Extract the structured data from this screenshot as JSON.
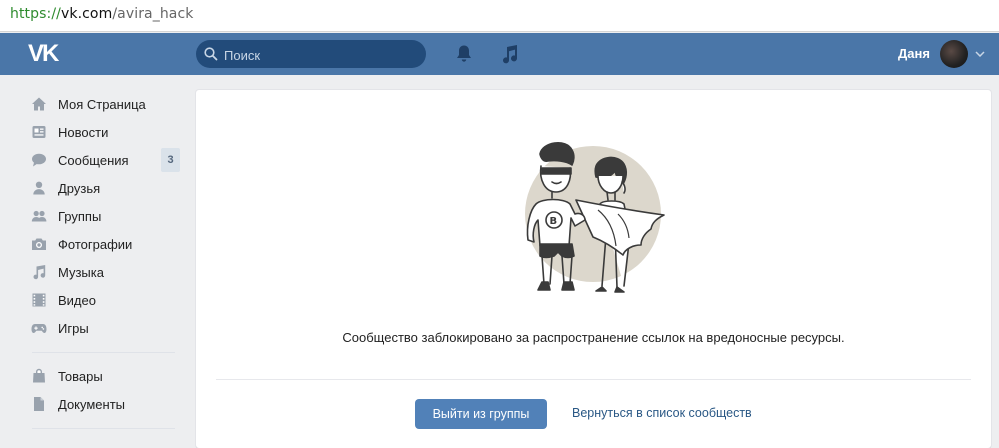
{
  "browser": {
    "url_scheme": "https://",
    "url_host": "vk.com",
    "url_path": "/avira_hack"
  },
  "header": {
    "logo": "VK",
    "search_placeholder": "Поиск",
    "user_name": "Даня"
  },
  "sidebar": {
    "items": [
      {
        "label": "Моя Страница",
        "icon": "home-icon"
      },
      {
        "label": "Новости",
        "icon": "news-icon"
      },
      {
        "label": "Сообщения",
        "icon": "messages-icon",
        "badge": "3"
      },
      {
        "label": "Друзья",
        "icon": "friends-icon"
      },
      {
        "label": "Группы",
        "icon": "groups-icon"
      },
      {
        "label": "Фотографии",
        "icon": "camera-icon"
      },
      {
        "label": "Музыка",
        "icon": "music-icon"
      },
      {
        "label": "Видео",
        "icon": "video-icon"
      },
      {
        "label": "Игры",
        "icon": "gamepad-icon"
      }
    ],
    "items2": [
      {
        "label": "Товары",
        "icon": "bag-icon"
      },
      {
        "label": "Документы",
        "icon": "document-icon"
      }
    ]
  },
  "main": {
    "message": "Сообщество заблокировано за распространение ссылок на вредоносные ресурсы.",
    "leave_button": "Выйти из группы",
    "back_link": "Вернуться в список сообществ"
  },
  "colors": {
    "header_bg": "#4a76a8",
    "page_bg": "#edeef0",
    "button_bg": "#5181b8",
    "link": "#2a5885",
    "icon": "#99a2ad"
  }
}
